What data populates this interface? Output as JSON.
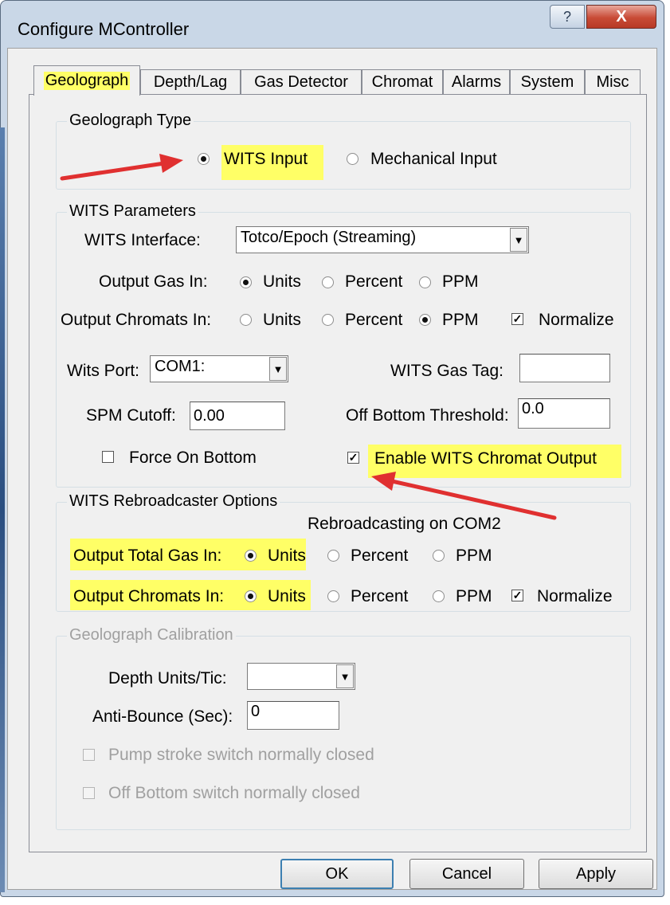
{
  "window": {
    "title": "Configure MController",
    "help_label": "?",
    "close_label": "X"
  },
  "tabs": [
    "Geolograph",
    "Depth/Lag",
    "Gas Detector",
    "Chromat",
    "Alarms",
    "System",
    "Misc"
  ],
  "geolograph_type": {
    "label": "Geolograph Type",
    "wits_input": "WITS  Input",
    "mechanical_input": "Mechanical Input",
    "selected": "WITS  Input"
  },
  "wits_parameters": {
    "label": "WITS Parameters",
    "interface_label": "WITS Interface:",
    "interface_value": "Totco/Epoch (Streaming)",
    "output_gas_label": "Output Gas In:",
    "output_chromats_label": "Output Chromats In:",
    "units": "Units",
    "percent": "Percent",
    "ppm": "PPM",
    "normalize": "Normalize",
    "wits_port_label": "Wits Port:",
    "wits_port_value": "COM1:",
    "wits_gas_tag_label": "WITS Gas Tag:",
    "wits_gas_tag_value": "",
    "spm_cutoff_label": "SPM Cutoff:",
    "spm_cutoff_value": "0.00",
    "off_bottom_threshold_label": "Off Bottom Threshold:",
    "off_bottom_threshold_value": "0.0",
    "force_on_bottom": "Force On Bottom",
    "enable_chromat_output": "Enable WITS Chromat Output"
  },
  "rebroadcaster": {
    "label": "WITS Rebroadcaster Options",
    "status": "Rebroadcasting on COM2",
    "total_gas_label": "Output Total Gas In:",
    "chromats_label": "Output Chromats In:",
    "units": "Units",
    "percent": "Percent",
    "ppm": "PPM",
    "normalize": "Normalize"
  },
  "calibration": {
    "label": "Geolograph Calibration",
    "depth_units_label": "Depth Units/Tic:",
    "depth_units_value": "",
    "anti_bounce_label": "Anti-Bounce (Sec):",
    "anti_bounce_value": "0",
    "pump_stroke": "Pump stroke switch normally closed",
    "off_bottom_switch": "Off Bottom switch normally closed"
  },
  "buttons": {
    "ok": "OK",
    "cancel": "Cancel",
    "apply": "Apply"
  },
  "colors": {
    "highlight": "#ffff66",
    "annotation_arrow": "#e03030"
  }
}
